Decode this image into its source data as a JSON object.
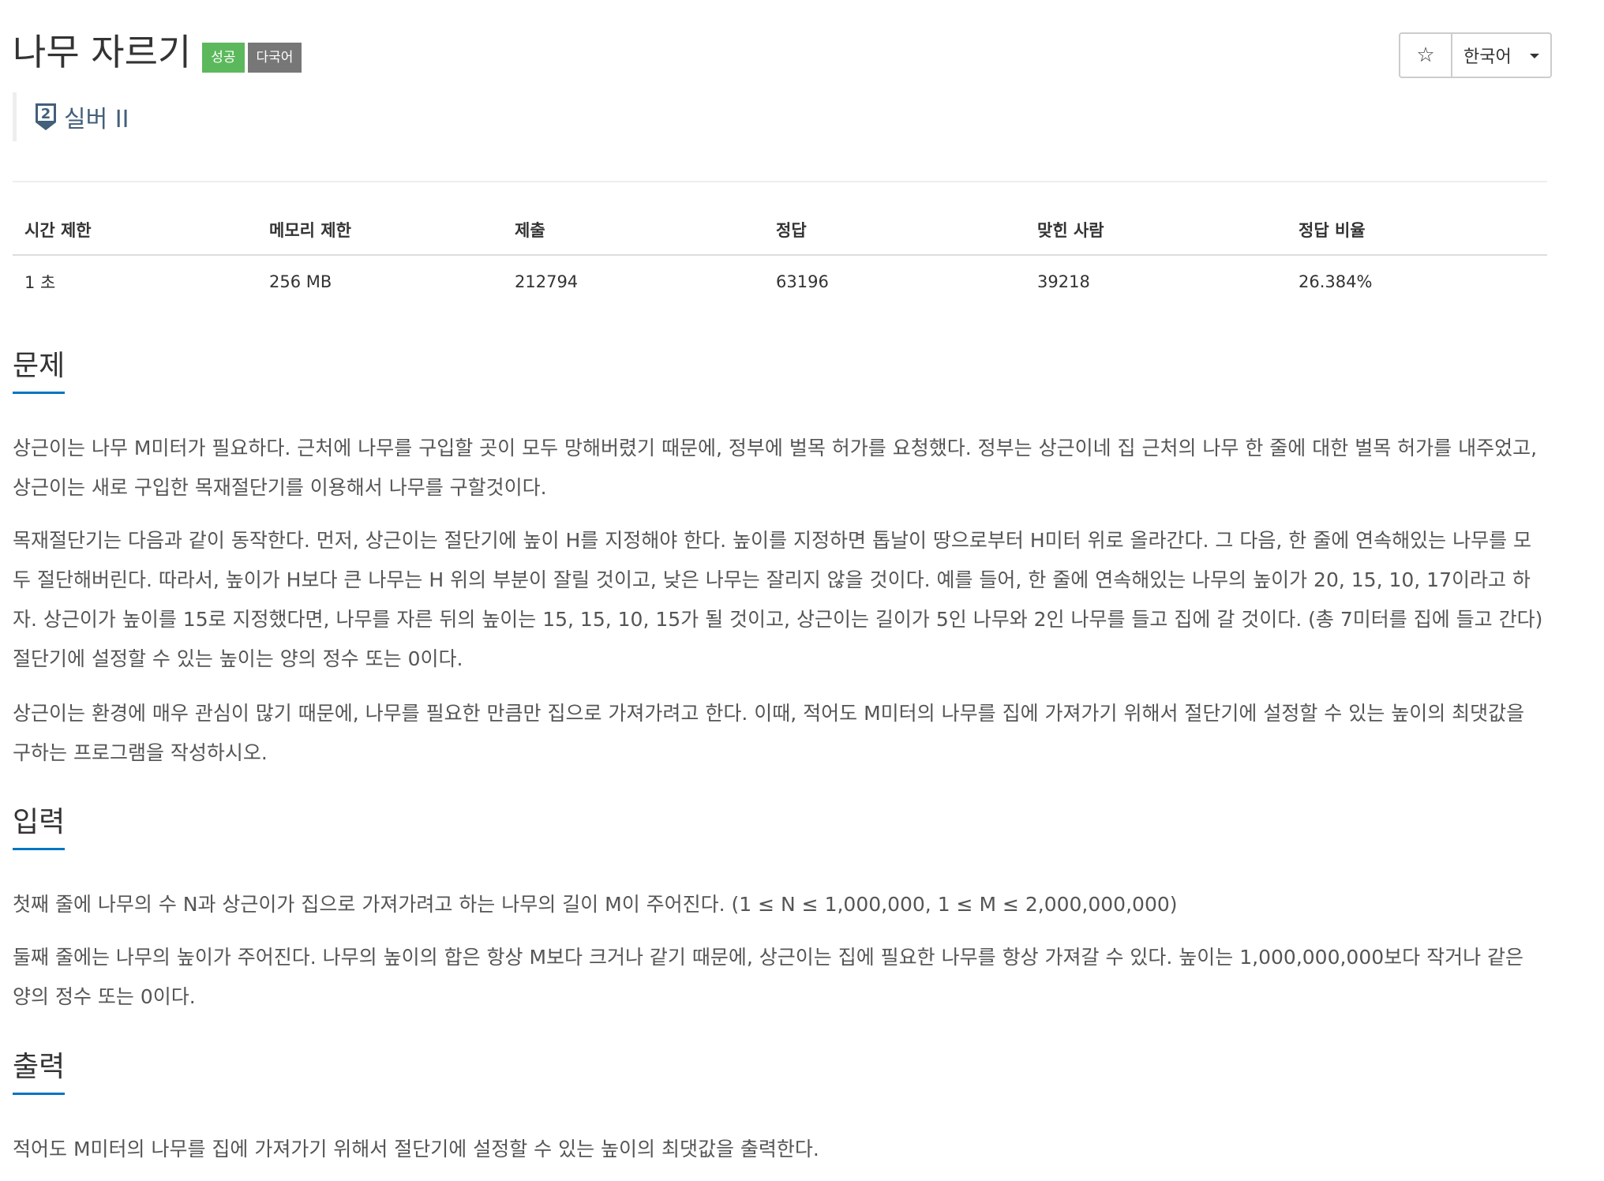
{
  "problem": {
    "title": "나무 자르기",
    "badges": {
      "success": "성공",
      "multilang": "다국어"
    },
    "tier": {
      "label": "실버 II",
      "level": "2",
      "icon": "silver-tier-icon"
    }
  },
  "actions": {
    "star": "☆",
    "language": "한국어"
  },
  "info": {
    "headers": [
      "시간 제한",
      "메모리 제한",
      "제출",
      "정답",
      "맞힌 사람",
      "정답 비율"
    ],
    "values": [
      "1 초",
      "256 MB",
      "212794",
      "63196",
      "39218",
      "26.384%"
    ]
  },
  "sections": {
    "problem": {
      "title": "문제",
      "paragraphs": [
        "상근이는 나무 M미터가 필요하다. 근처에 나무를 구입할 곳이 모두 망해버렸기 때문에, 정부에 벌목 허가를 요청했다. 정부는 상근이네 집 근처의 나무 한 줄에 대한 벌목 허가를 내주었고, 상근이는 새로 구입한 목재절단기를 이용해서 나무를 구할것이다.",
        "목재절단기는 다음과 같이 동작한다. 먼저, 상근이는 절단기에 높이 H를 지정해야 한다. 높이를 지정하면 톱날이 땅으로부터 H미터 위로 올라간다. 그 다음, 한 줄에 연속해있는 나무를 모두 절단해버린다. 따라서, 높이가 H보다 큰 나무는 H 위의 부분이 잘릴 것이고, 낮은 나무는 잘리지 않을 것이다. 예를 들어, 한 줄에 연속해있는 나무의 높이가 20, 15, 10, 17이라고 하자. 상근이가 높이를 15로 지정했다면, 나무를 자른 뒤의 높이는 15, 15, 10, 15가 될 것이고, 상근이는 길이가 5인 나무와 2인 나무를 들고 집에 갈 것이다. (총 7미터를 집에 들고 간다) 절단기에 설정할 수 있는 높이는 양의 정수 또는 0이다.",
        "상근이는 환경에 매우 관심이 많기 때문에, 나무를 필요한 만큼만 집으로 가져가려고 한다. 이때, 적어도 M미터의 나무를 집에 가져가기 위해서 절단기에 설정할 수 있는 높이의 최댓값을 구하는 프로그램을 작성하시오."
      ]
    },
    "input": {
      "title": "입력",
      "paragraphs": [
        "첫째 줄에 나무의 수 N과 상근이가 집으로 가져가려고 하는 나무의 길이 M이 주어진다. (1 ≤ N ≤ 1,000,000, 1 ≤ M ≤ 2,000,000,000)",
        "둘째 줄에는 나무의 높이가 주어진다. 나무의 높이의 합은 항상 M보다 크거나 같기 때문에, 상근이는 집에 필요한 나무를 항상 가져갈 수 있다. 높이는 1,000,000,000보다 작거나 같은 양의 정수 또는 0이다."
      ]
    },
    "output": {
      "title": "출력",
      "paragraphs": [
        "적어도 M미터의 나무를 집에 가져가기 위해서 절단기에 설정할 수 있는 높이의 최댓값을 출력한다."
      ]
    }
  },
  "colors": {
    "success": "#5cb85c",
    "multilang": "#777777",
    "section_underline": "#0076c0",
    "tier": "#435f7a"
  }
}
